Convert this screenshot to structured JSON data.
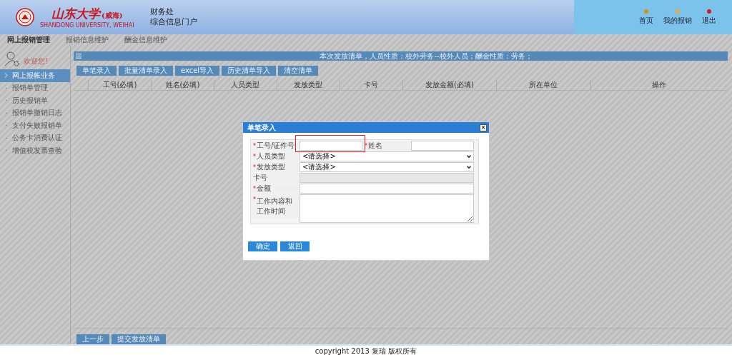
{
  "header": {
    "logo_name": "山东大学",
    "logo_campus": "(威海)",
    "logo_english": "SHANDONG UNIVERSITY, WEIHAI",
    "department": "财务处",
    "portal": "综合信息门户",
    "links": [
      {
        "label": "首页",
        "color": "#e08a00"
      },
      {
        "label": "我的报销",
        "color": "#f0a830"
      },
      {
        "label": "退出",
        "color": "#e01020"
      }
    ]
  },
  "nav_tabs": [
    {
      "label": "网上报销管理",
      "selected": true
    },
    {
      "label": "报销信息维护",
      "selected": false
    },
    {
      "label": "酬金信息维护",
      "selected": false
    }
  ],
  "user": {
    "greeting": "欢迎您!"
  },
  "sidebar": {
    "items": [
      {
        "label": "网上报帐业务",
        "selected": true
      },
      {
        "label": "报销单管理",
        "selected": false
      },
      {
        "label": "历史报销单",
        "selected": false
      },
      {
        "label": "报销单撤销日志",
        "selected": false
      },
      {
        "label": "支付失败报销单",
        "selected": false
      },
      {
        "label": "公务卡消费认证",
        "selected": false
      },
      {
        "label": "增值税发票查验",
        "selected": false
      }
    ]
  },
  "main": {
    "info": "本次发放清单，人员性质：校外劳务--校外人员；酬金性质：劳务；",
    "toolbar": [
      "单笔录入",
      "批量清单录入",
      "excel导入",
      "历史清单导入",
      "清空清单"
    ],
    "table": {
      "columns": [
        "工号(必填)",
        "姓名(必填)",
        "人员类型",
        "发放类型",
        "卡号",
        "发放金额(必填)",
        "所在单位",
        "操作"
      ]
    },
    "footer_buttons": [
      "上一步",
      "提交发放清单"
    ]
  },
  "dialog": {
    "title": "单笔录入",
    "close": "×",
    "rows": [
      {
        "kind": "pair",
        "fields": [
          {
            "label": "工号/证件号",
            "required": true,
            "highlighted": true
          },
          {
            "label": "姓名",
            "required": true,
            "highlighted": false
          }
        ]
      },
      {
        "kind": "select",
        "label": "人员类型",
        "required": true,
        "value": "<请选择>"
      },
      {
        "kind": "select",
        "label": "发放类型",
        "required": true,
        "value": "<请选择>"
      },
      {
        "kind": "readonly",
        "label": "卡号",
        "required": false
      },
      {
        "kind": "text",
        "label": "金额",
        "required": true
      },
      {
        "kind": "textarea",
        "label": "工作内容和工作时间",
        "required": true
      }
    ],
    "buttons": [
      "确定",
      "返回"
    ]
  },
  "status_bar": {
    "copyright": "copyright 2013 复瑞 版权所有"
  }
}
